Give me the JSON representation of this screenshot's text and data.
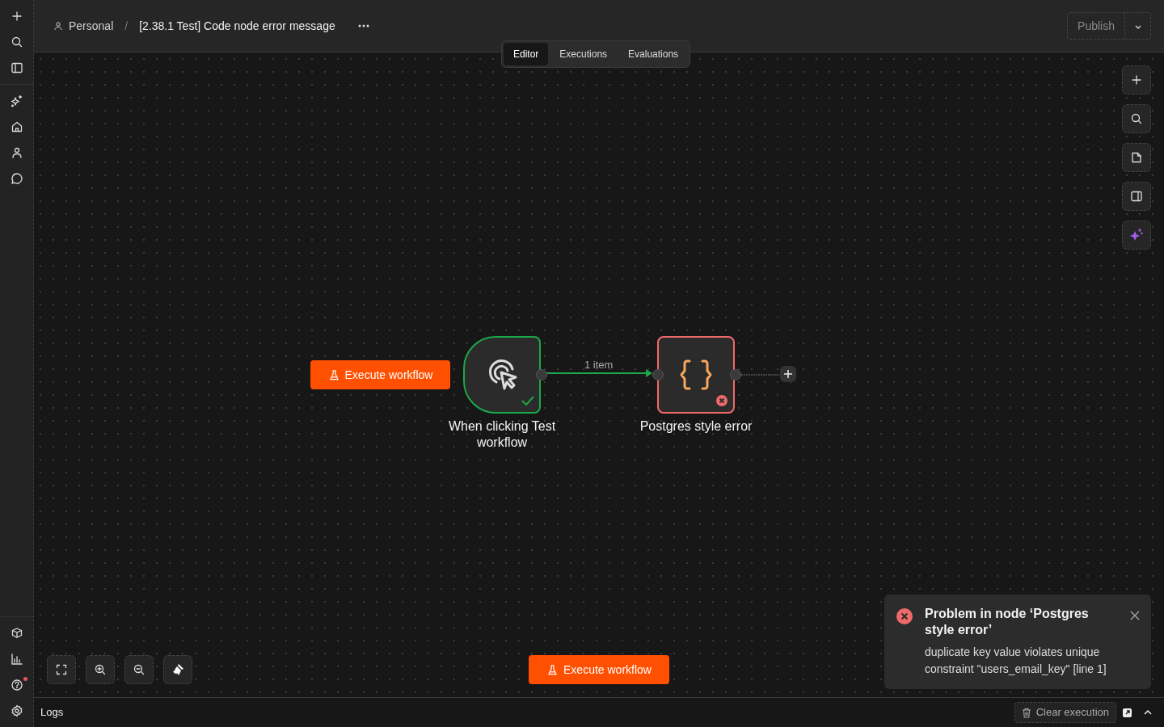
{
  "breadcrumb": {
    "project": "Personal",
    "separator": "/",
    "workflow": "[2.38.1 Test] Code node error message"
  },
  "publish": {
    "label": "Publish",
    "disabled": true
  },
  "tabs": [
    {
      "label": "Editor",
      "selected": true
    },
    {
      "label": "Executions",
      "selected": false
    },
    {
      "label": "Evaluations",
      "selected": false
    }
  ],
  "help_has_notification": true,
  "nodes": [
    {
      "kind": "trigger",
      "name": "When clicking Test workflow",
      "succeeded": true,
      "failed": false
    },
    {
      "kind": "code",
      "name": "Postgres style error",
      "succeeded": false,
      "failed": true
    }
  ],
  "connection": {
    "label": "1 item"
  },
  "trigger_button": {
    "label": "Execute workflow"
  },
  "footer_button": {
    "label": "Execute workflow"
  },
  "toast": {
    "title": "Problem in node ‘Postgres style error’",
    "message": "duplicate key value violates unique constraint \"users_email_key\" [line 1]"
  },
  "logs": {
    "title": "Logs",
    "clear_button": "Clear execution"
  }
}
